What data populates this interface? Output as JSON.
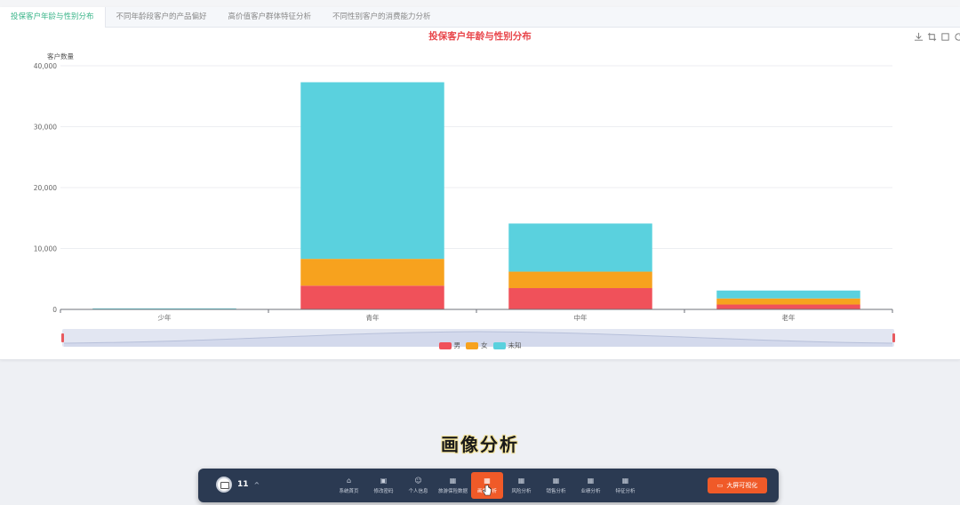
{
  "tabs": [
    {
      "label": "投保客户年龄与性别分布",
      "active": true
    },
    {
      "label": "不同年龄段客户的产品偏好",
      "active": false
    },
    {
      "label": "高价值客户群体特征分析",
      "active": false
    },
    {
      "label": "不同性别客户的消费能力分析",
      "active": false
    }
  ],
  "toolbox": [
    "download-icon",
    "zoom-icon",
    "restore-icon",
    "refresh-icon"
  ],
  "chart_data": {
    "type": "bar",
    "stacked": true,
    "title": "投保客户年龄与性别分布",
    "ylabel": "客户数量",
    "xlabel": "",
    "categories": [
      "少年",
      "青年",
      "中年",
      "老年"
    ],
    "ylim": [
      0,
      40000
    ],
    "yticks": [
      "0",
      "10,000",
      "20,000",
      "30,000",
      "40,000"
    ],
    "series": [
      {
        "name": "男",
        "color": "#f0515a",
        "values": [
          20,
          3900,
          3500,
          800
        ]
      },
      {
        "name": "女",
        "color": "#f7a21e",
        "values": [
          60,
          4400,
          2700,
          1000
        ]
      },
      {
        "name": "未知",
        "color": "#5ad1de",
        "values": [
          40,
          29000,
          7900,
          1300
        ]
      }
    ],
    "grid": true,
    "legend_position": "bottom"
  },
  "caption": "画像分析",
  "dock": {
    "user_count": "11",
    "nav": [
      {
        "label": "系统首页",
        "icon": "home-icon",
        "glyph": "⌂",
        "active": false
      },
      {
        "label": "修改密码",
        "icon": "lock-icon",
        "glyph": "▣",
        "active": false
      },
      {
        "label": "个人信息",
        "icon": "user-icon",
        "glyph": "☺",
        "active": false
      },
      {
        "label": "旅游保险数据",
        "icon": "grid-icon",
        "glyph": "▦",
        "active": false
      },
      {
        "label": "画像分析",
        "icon": "grid-icon",
        "glyph": "▦",
        "active": true
      },
      {
        "label": "风险分析",
        "icon": "grid-icon",
        "glyph": "▦",
        "active": false
      },
      {
        "label": "销售分析",
        "icon": "grid-icon",
        "glyph": "▦",
        "active": false
      },
      {
        "label": "业绩分析",
        "icon": "grid-icon",
        "glyph": "▦",
        "active": false
      },
      {
        "label": "特征分析",
        "icon": "grid-icon",
        "glyph": "▦",
        "active": false
      }
    ],
    "cta_label": "大屏可视化"
  }
}
